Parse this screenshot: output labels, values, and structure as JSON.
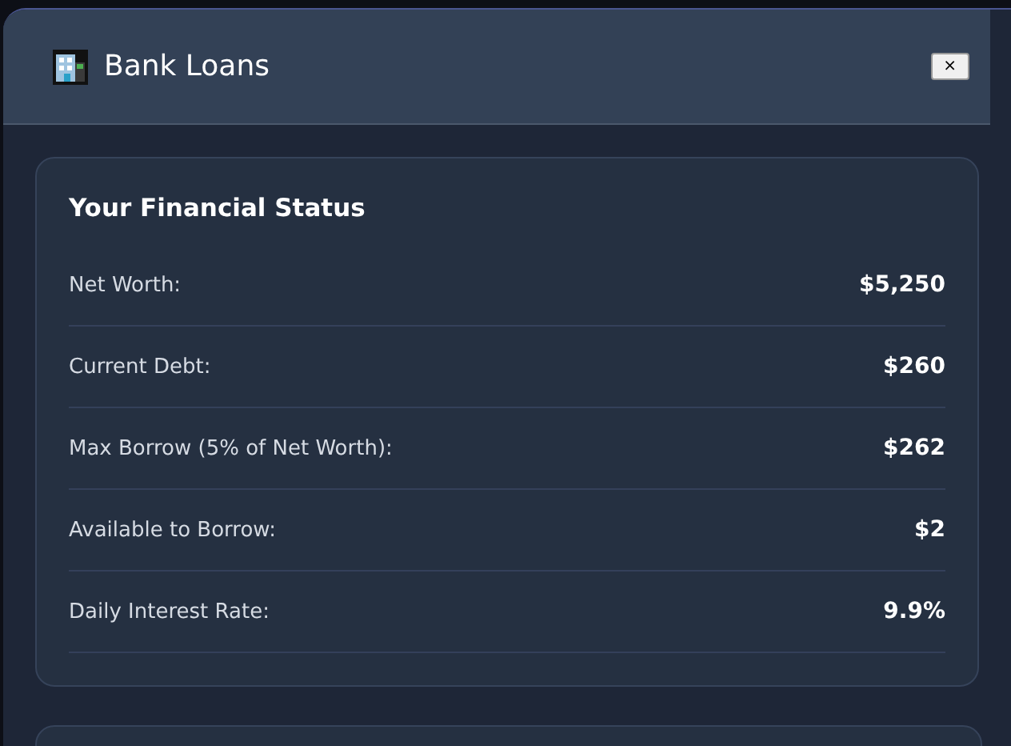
{
  "window": {
    "title": "Bank Loans",
    "close": "×"
  },
  "status_card": {
    "title": "Your Financial Status",
    "rows": [
      {
        "label": "Net Worth:",
        "value": "$5,250"
      },
      {
        "label": "Current Debt:",
        "value": "$260"
      },
      {
        "label": "Max Borrow (5% of Net Worth):",
        "value": "$262"
      },
      {
        "label": "Available to Borrow:",
        "value": "$2"
      },
      {
        "label": "Daily Interest Rate:",
        "value": "9.9%"
      }
    ]
  }
}
